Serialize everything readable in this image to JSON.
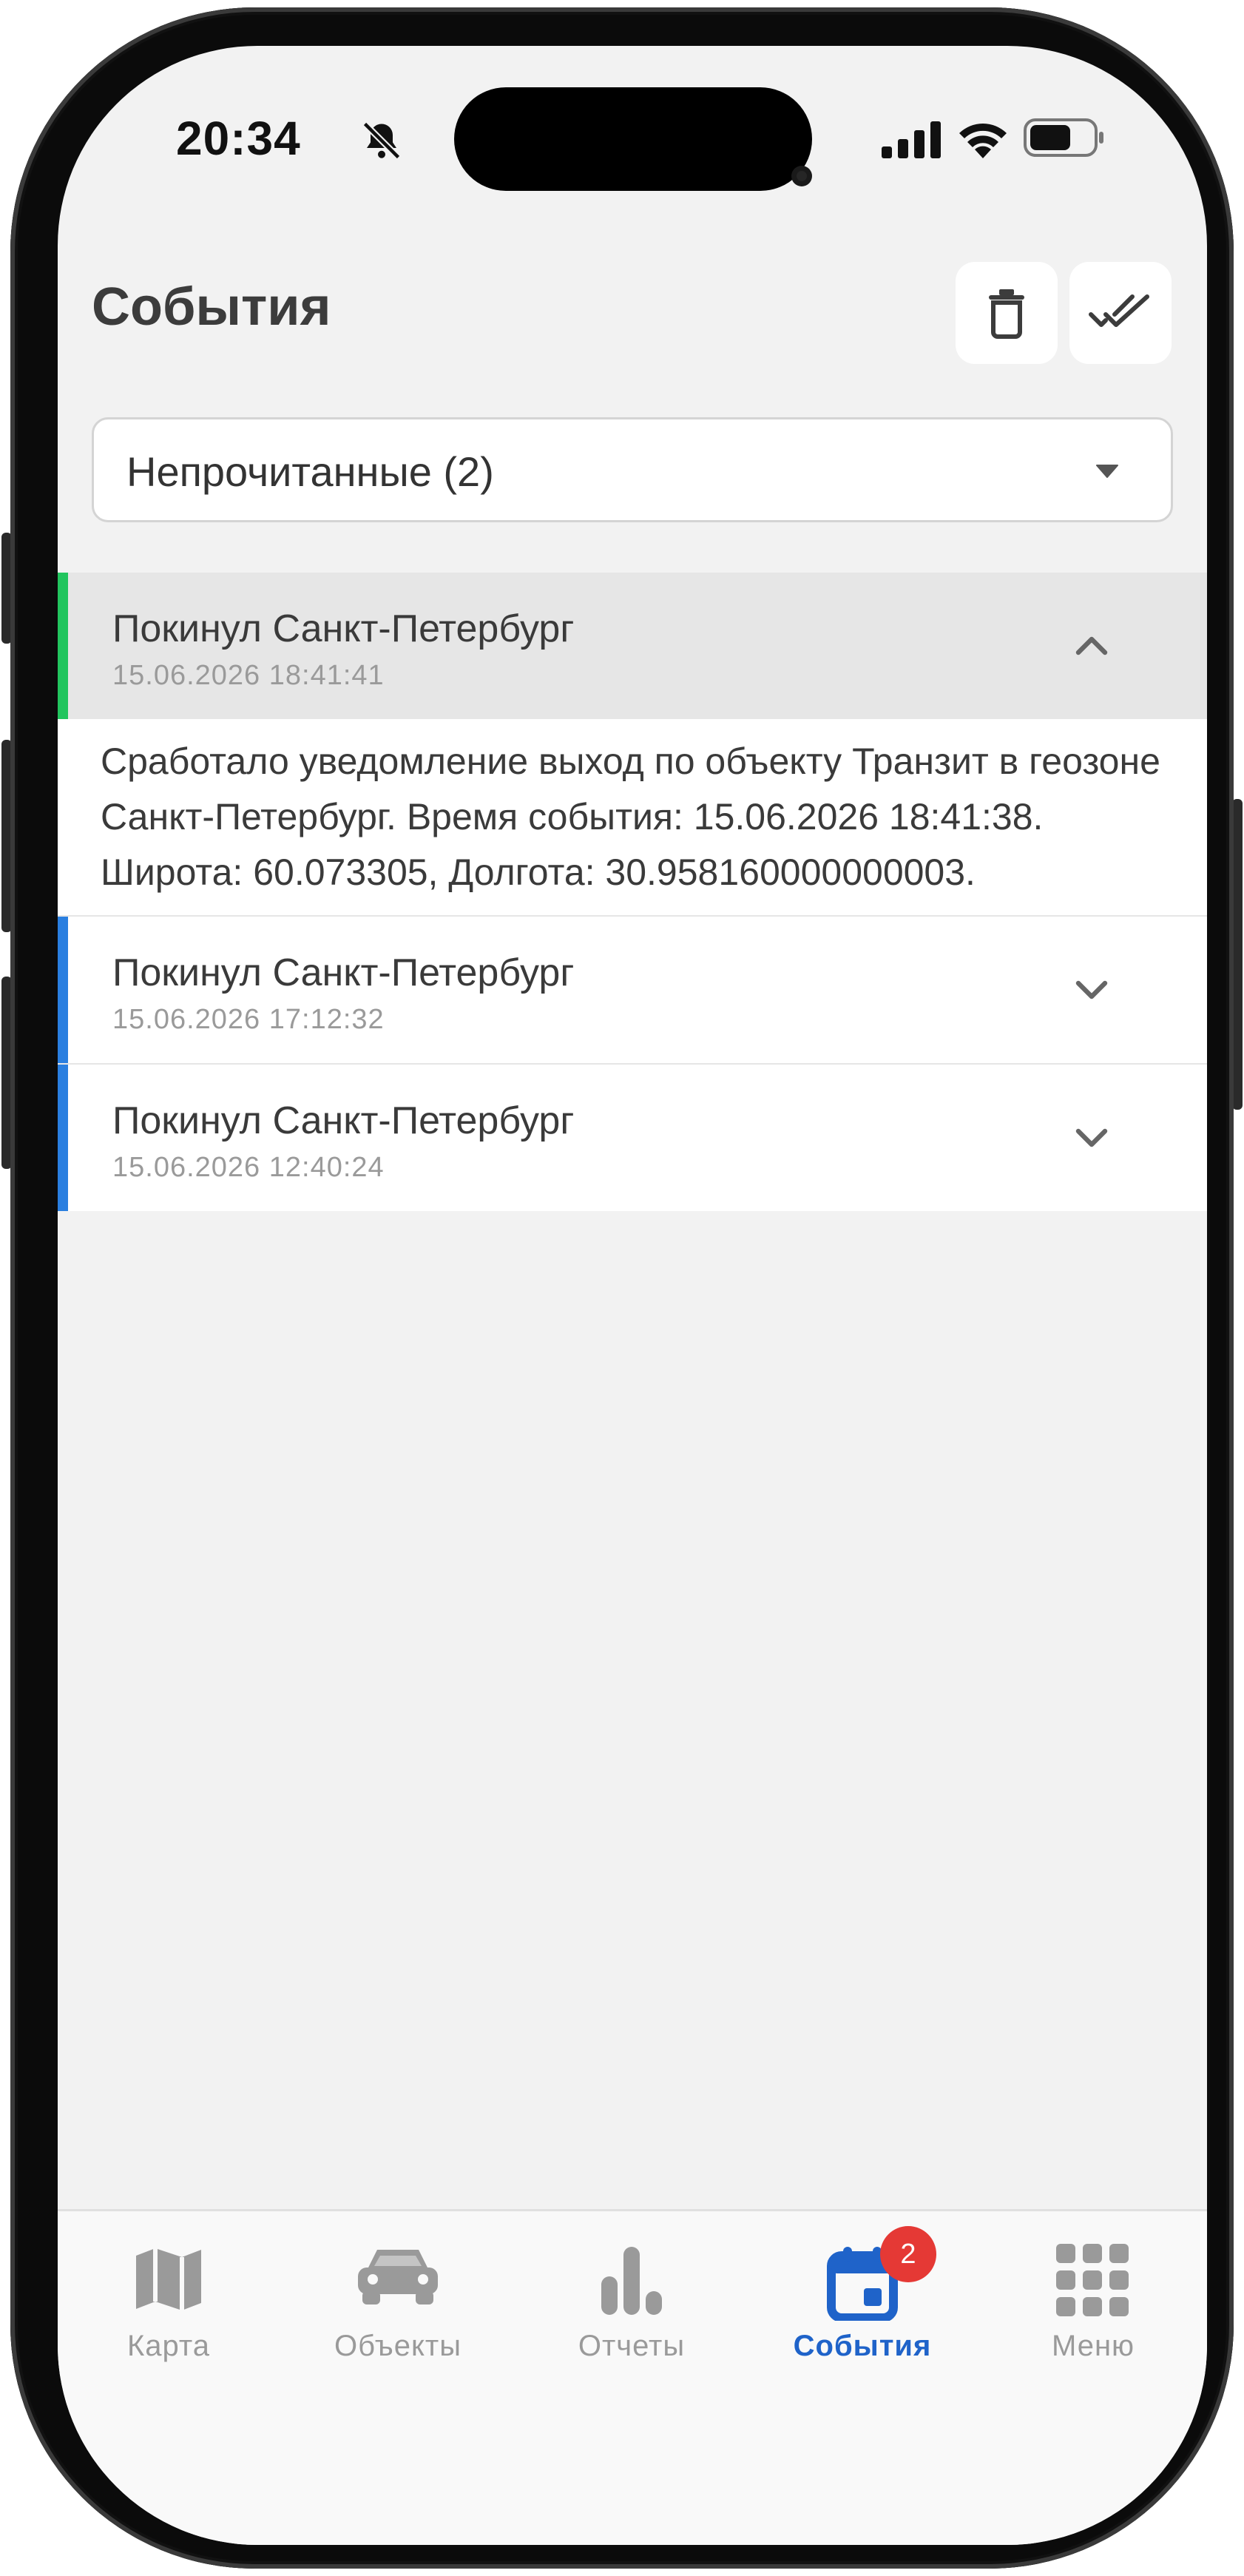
{
  "status_bar": {
    "time": "20:34",
    "icons": [
      "bell-slash-icon",
      "signal-icon",
      "wifi-icon",
      "battery-icon"
    ]
  },
  "header": {
    "title": "События",
    "actions": [
      {
        "name": "delete",
        "icon": "trash-icon"
      },
      {
        "name": "mark-all-read",
        "icon": "double-check-icon"
      }
    ]
  },
  "filter": {
    "selected": "Непрочитанные (2)",
    "icon": "caret-down-icon"
  },
  "events": [
    {
      "title": "Покинул Санкт-Петербург",
      "date": "15.06.2026 18:41:41",
      "accent": "#22c55e",
      "expanded": true,
      "details": "Сработало уведомление выход по объекту Транзит в геозоне Санкт-Петербург. Время события: 15.06.2026 18:41:38. Широта: 60.073305, Долгота: 30.958160000000003."
    },
    {
      "title": "Покинул Санкт-Петербург",
      "date": "15.06.2026 17:12:32",
      "accent": "#2a7fe0",
      "expanded": false
    },
    {
      "title": "Покинул Санкт-Петербург",
      "date": "15.06.2026 12:40:24",
      "accent": "#2a7fe0",
      "expanded": false
    }
  ],
  "tabbar": {
    "tabs": [
      {
        "label": "Карта",
        "icon": "map-icon",
        "active": false
      },
      {
        "label": "Объекты",
        "icon": "car-icon",
        "active": false
      },
      {
        "label": "Отчеты",
        "icon": "bar-chart-icon",
        "active": false
      },
      {
        "label": "События",
        "icon": "calendar-icon",
        "active": true,
        "badge": "2"
      },
      {
        "label": "Меню",
        "icon": "grid-icon",
        "active": false
      }
    ]
  },
  "colors": {
    "accent_active": "#1f63c9",
    "unread_new": "#22c55e",
    "unread": "#2a7fe0",
    "badge": "#e53935"
  }
}
